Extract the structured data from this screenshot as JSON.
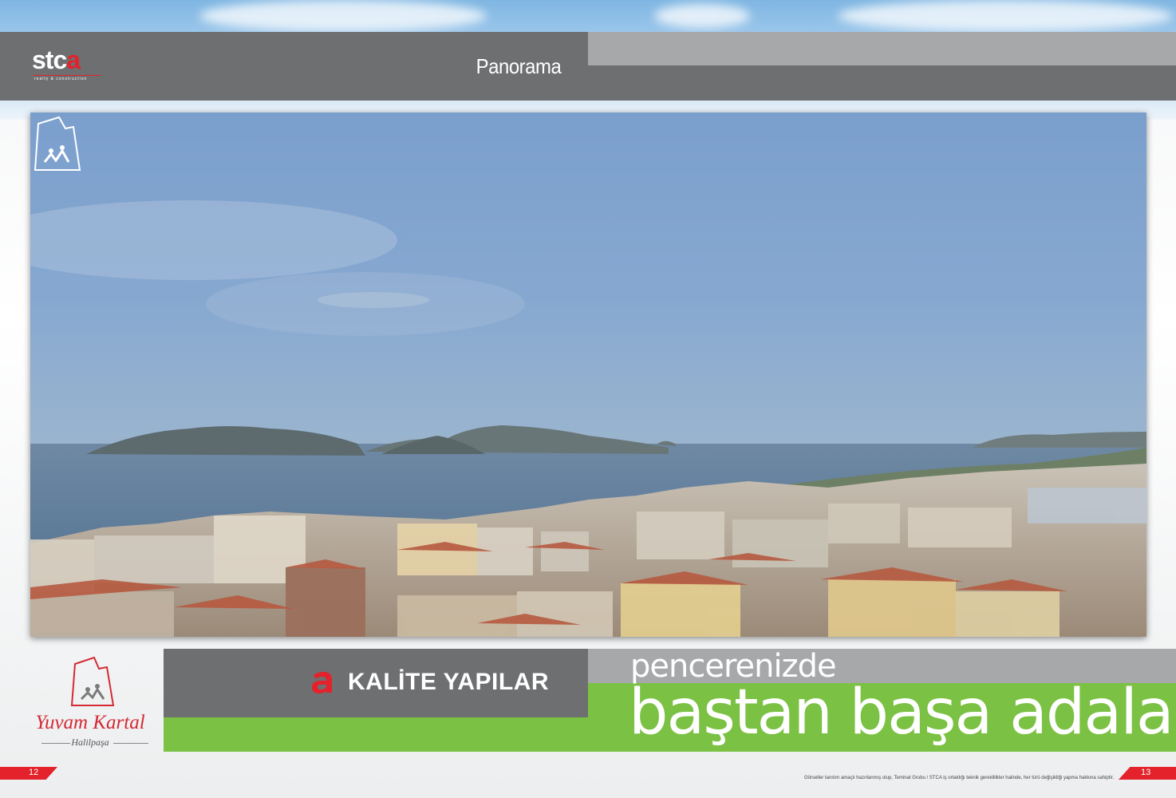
{
  "header": {
    "logo_text_main": "stc",
    "logo_text_accent": "a",
    "logo_tagline": "realty & construction",
    "title": "Panorama"
  },
  "footer": {
    "brand_name": "Yuvam Kartal",
    "brand_sub": "Halilpaşa",
    "kalite_text": "KALİTE YAPILAR",
    "headline_small": "pencerenizde",
    "headline_large": "baştan başa adalar",
    "page_left": "12",
    "page_right": "13",
    "disclaimer": "Görseller tanıtım amaçlı hazırlanmış olup, Teminat Grubu / STCA iş ortaklığı teknik gereklilikler halinde, her türü değişikliği yapma hakkına sahiptir."
  },
  "colors": {
    "header_grey": "#6e6f71",
    "light_grey": "#a7a8aa",
    "accent_green": "#7bc143",
    "accent_red": "#e3222b"
  }
}
